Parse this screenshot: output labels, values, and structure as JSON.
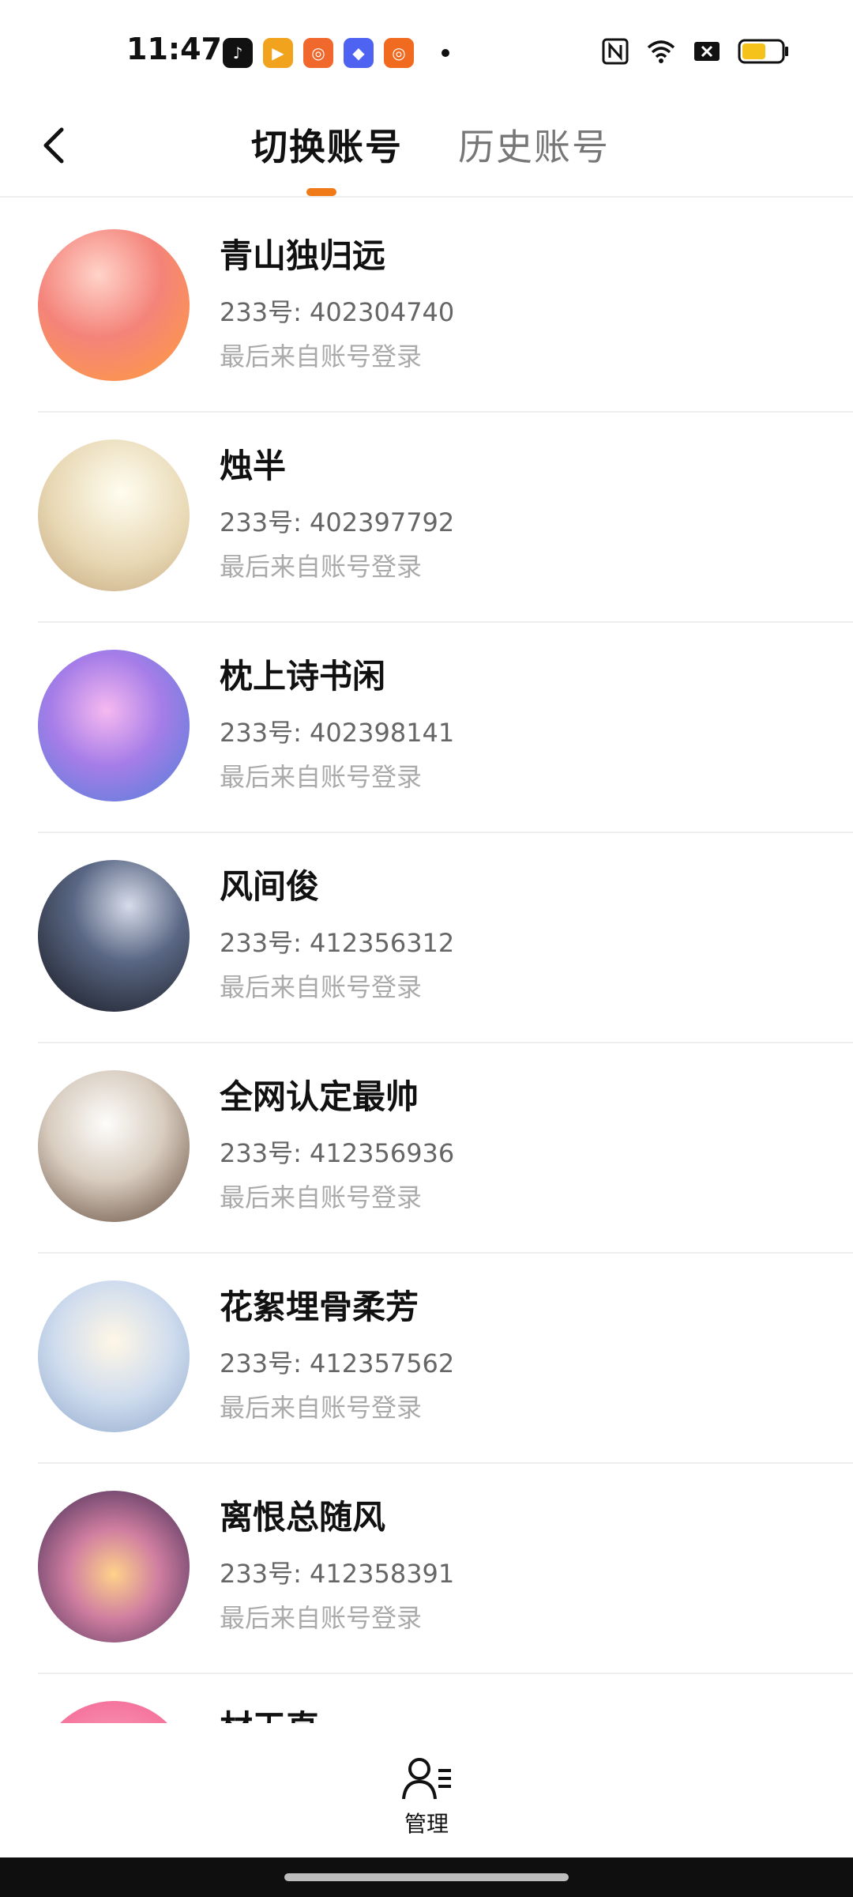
{
  "status_bar": {
    "time": "11:47",
    "apps": [
      {
        "name": "tiktok-icon",
        "glyph": "♪",
        "color": "#111111"
      },
      {
        "name": "video-app-icon",
        "glyph": "▶",
        "color": "#f1a31d"
      },
      {
        "name": "kuaishou-icon",
        "glyph": "◎",
        "color": "#f0682c"
      },
      {
        "name": "shortcut-app-icon",
        "glyph": "◆",
        "color": "#4e63f2"
      },
      {
        "name": "kuaishou-alt-icon",
        "glyph": "◎",
        "color": "#f06a1f"
      }
    ],
    "battery_level": 0.6
  },
  "header": {
    "tab_active": "切换账号",
    "tab_inactive": "历史账号",
    "accent": "#f07a18"
  },
  "accounts": [
    {
      "name": "青山独归远",
      "id": "233号: 402304740",
      "from": "最后来自账号登录"
    },
    {
      "name": "烛半",
      "id": "233号: 402397792",
      "from": "最后来自账号登录"
    },
    {
      "name": "枕上诗书闲",
      "id": "233号: 402398141",
      "from": "最后来自账号登录"
    },
    {
      "name": "风间俊",
      "id": "233号: 412356312",
      "from": "最后来自账号登录"
    },
    {
      "name": "全网认定最帅",
      "id": "233号: 412356936",
      "from": "最后来自账号登录"
    },
    {
      "name": "花絮埋骨柔芳",
      "id": "233号: 412357562",
      "from": "最后来自账号登录"
    },
    {
      "name": "离恨总随风",
      "id": "233号: 412358391",
      "from": "最后来自账号登录"
    },
    {
      "name": "材天直",
      "id": "",
      "from": ""
    }
  ],
  "bottom": {
    "manage_label": "管理"
  }
}
